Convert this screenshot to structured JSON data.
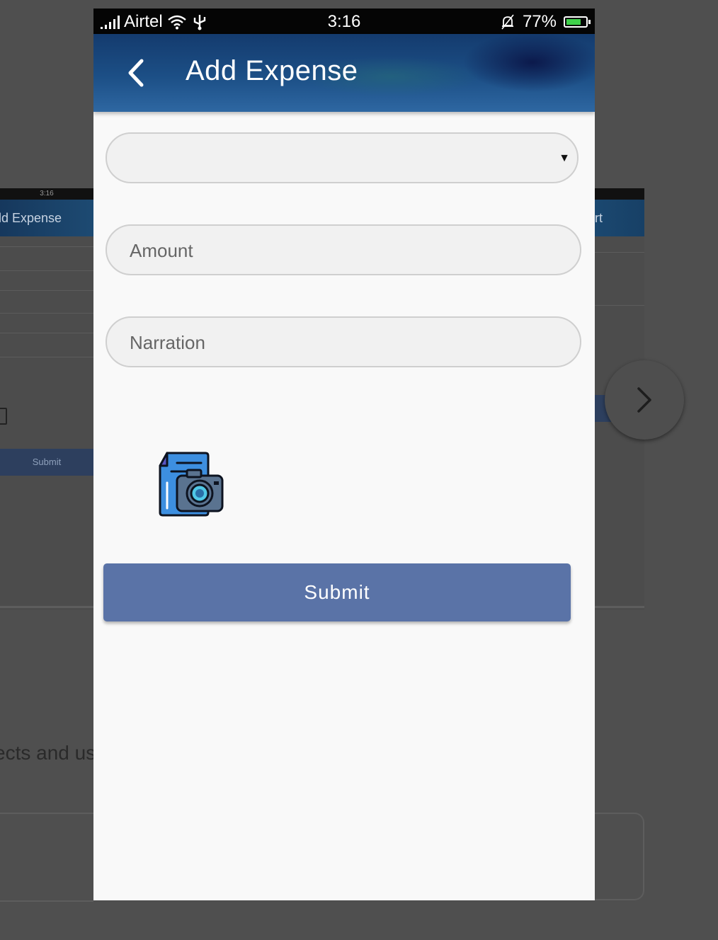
{
  "status_bar": {
    "carrier": "Airtel",
    "time": "3:16",
    "battery": "77%",
    "battery_level": 0.77
  },
  "app_bar": {
    "title": "Add Expense",
    "back_icon": "chevron-left-icon"
  },
  "form": {
    "category_dropdown": {
      "value": "",
      "arrow": "▼"
    },
    "amount": {
      "placeholder": "Amount"
    },
    "narration": {
      "placeholder": "Narration"
    },
    "attachment_icon": "document-camera-icon",
    "submit_label": "Submit"
  },
  "background": {
    "left_time": "3:16",
    "left_title": "dd Expense",
    "left_submit": "Submit",
    "right_title": "rt",
    "text_fragment": "ects and us",
    "next_icon": "chevron-right-icon"
  },
  "colors": {
    "app_bar": "#1c4f86",
    "submit": "#5a73a7",
    "field_bg": "#f1f1f1"
  }
}
